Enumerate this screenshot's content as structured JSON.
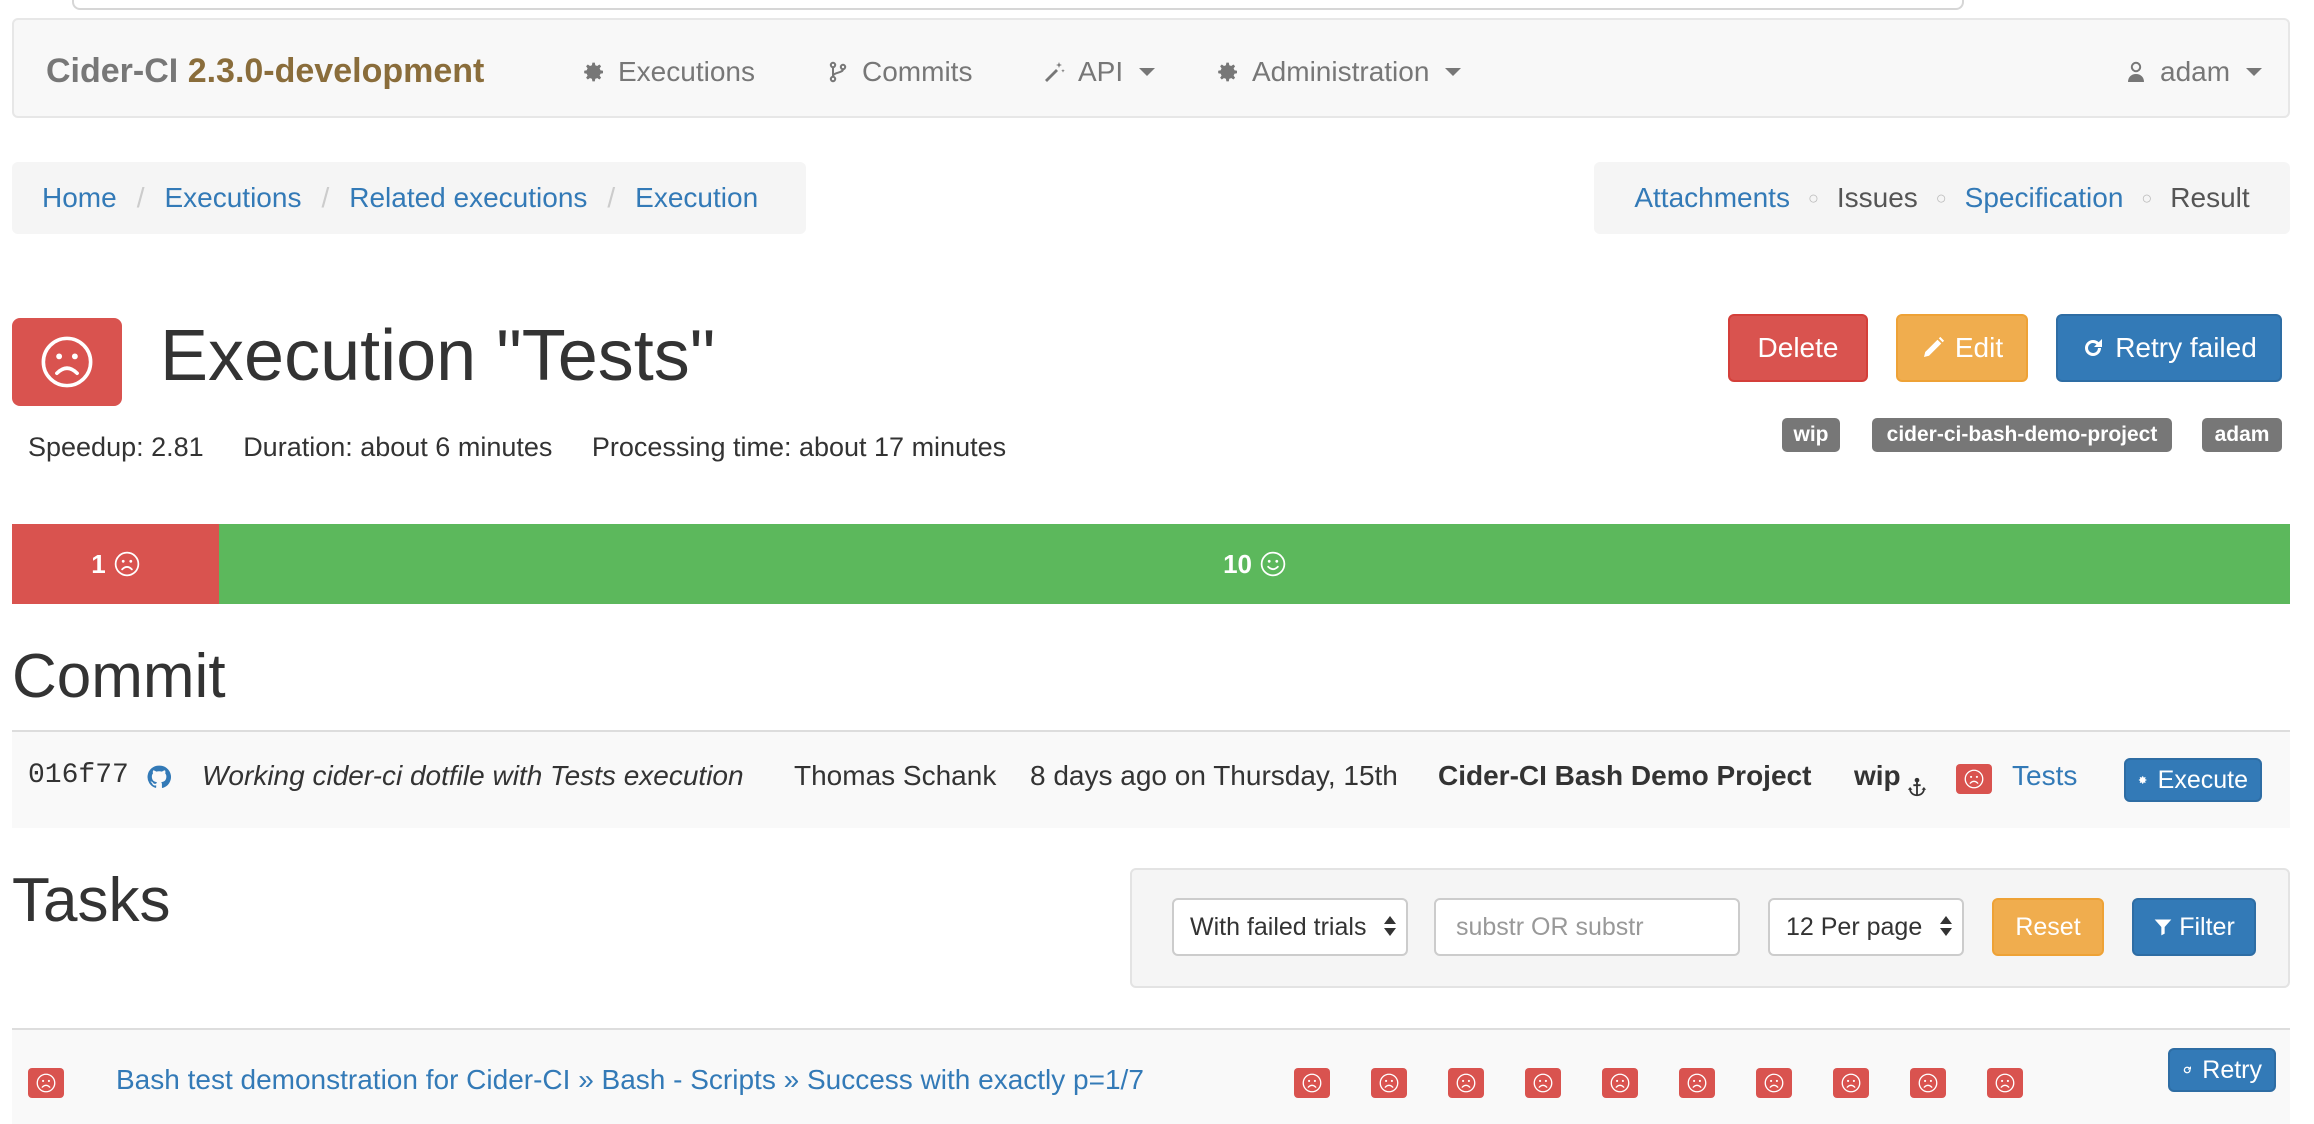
{
  "navbar": {
    "brand_name": "Cider-CI",
    "brand_version": "2.3.0-development",
    "items": [
      {
        "label": "Executions",
        "icon": "gear-icon"
      },
      {
        "label": "Commits",
        "icon": "branch-icon"
      },
      {
        "label": "API",
        "icon": "magic-wand-icon"
      },
      {
        "label": "Administration",
        "icon": "gear-icon"
      }
    ],
    "user": "adam"
  },
  "breadcrumb": [
    "Home",
    "Executions",
    "Related executions",
    "Execution"
  ],
  "subnav": [
    "Attachments",
    "Issues",
    "Specification",
    "Result"
  ],
  "execution": {
    "title": "Execution \"Tests\"",
    "status": "failed",
    "stats": {
      "speedup": "Speedup: 2.81",
      "duration": "Duration: about 6 minutes",
      "processing": "Processing time: about 17 minutes"
    },
    "tags": [
      "wip",
      "cider-ci-bash-demo-project",
      "adam"
    ]
  },
  "actions": {
    "delete": "Delete",
    "edit": "Edit",
    "retry_failed": "Retry failed"
  },
  "progress": {
    "failed_count": "1",
    "passed_count": "10",
    "failed_fraction": 0.0909
  },
  "commit_section": {
    "heading": "Commit",
    "sha": "016f77",
    "message": "Working cider-ci dotfile with Tests execution",
    "author": "Thomas Schank",
    "date": "8 days ago on Thursday, 15th",
    "project": "Cider-CI Bash Demo Project",
    "branch": "wip",
    "execution_link": "Tests",
    "execute_button": "Execute"
  },
  "tasks_section": {
    "heading": "Tasks",
    "filter": {
      "state_select": "With failed trials",
      "search_placeholder": "substr OR substr",
      "per_page_select": "12 Per page",
      "reset": "Reset",
      "filter": "Filter"
    },
    "rows": [
      {
        "name": "Bash test demonstration for Cider-CI » Bash - Scripts » Success with exactly p=1/7",
        "trials": [
          "failed",
          "failed",
          "failed",
          "failed",
          "failed",
          "failed",
          "failed",
          "failed",
          "failed",
          "failed"
        ],
        "retry": "Retry"
      }
    ]
  },
  "colors": {
    "danger": "#d9534f",
    "warning": "#f0ad4e",
    "primary": "#337ab7",
    "success": "#5cb85c",
    "brand_version": "#8a6d3b"
  }
}
